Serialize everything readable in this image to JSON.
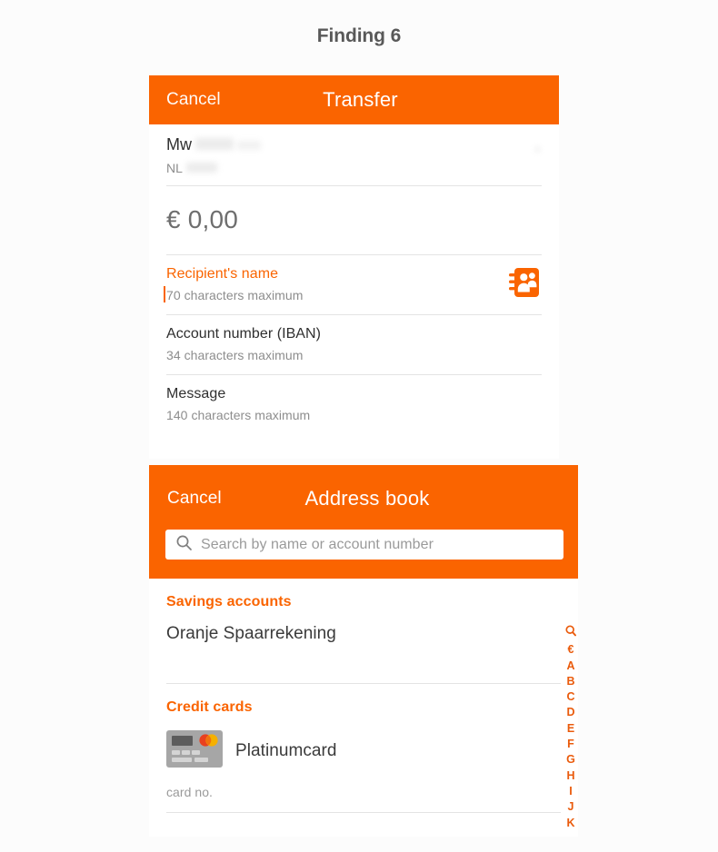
{
  "page": {
    "title": "Finding 6",
    "background": "#fcfcfc",
    "accent": "#fa6400",
    "index_accent": "#ea5b0c"
  },
  "transfer_screen": {
    "cancel_label": "Cancel",
    "title": "Transfer",
    "account": {
      "name": "Mw",
      "iban_prefix": "NL",
      "redacted": true
    },
    "amount": "€ 0,00",
    "fields": [
      {
        "label": "Recipient's name",
        "hint": "70 characters maximum",
        "active": true,
        "has_caret": true,
        "action_icon": "address-book-icon"
      },
      {
        "label": "Account number (IBAN)",
        "hint": "34 characters maximum",
        "active": false,
        "has_caret": false
      },
      {
        "label": "Message",
        "hint": "140 characters maximum",
        "active": false,
        "has_caret": false
      }
    ]
  },
  "addressbook_screen": {
    "cancel_label": "Cancel",
    "title": "Address book",
    "search": {
      "placeholder": "Search by name or account number",
      "value": "",
      "icon": "search-icon"
    },
    "groups": [
      {
        "header": "Savings accounts",
        "items": [
          {
            "name": "Oranje Spaarrekening",
            "subtitle": "",
            "thumb": ""
          }
        ]
      },
      {
        "header": "Credit cards",
        "items": [
          {
            "name": "Platinumcard",
            "subtitle": "card no.",
            "thumb": "credit-card-icon"
          }
        ]
      }
    ],
    "index_strip": {
      "icon": "search-icon",
      "entries": [
        "€",
        "A",
        "B",
        "C",
        "D",
        "E",
        "F",
        "G",
        "H",
        "I",
        "J",
        "K"
      ]
    }
  }
}
